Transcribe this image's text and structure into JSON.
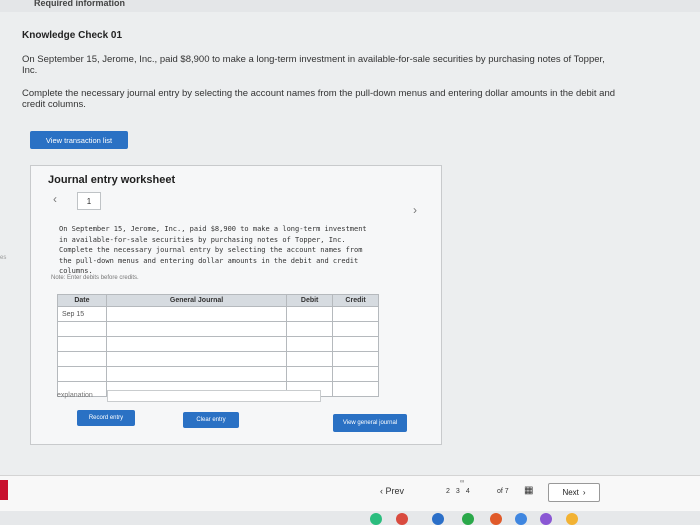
{
  "header": {
    "required_label": "Required information"
  },
  "question": {
    "title": "Knowledge Check 01",
    "paragraph1": "On September 15, Jerome, Inc., paid $8,900 to make a long-term investment in available-for-sale securities by purchasing notes of Topper, Inc.",
    "paragraph2": "Complete the necessary journal entry by selecting the account names from the pull-down menus and entering dollar amounts in the debit and credit columns."
  },
  "buttons": {
    "view_transaction_list": "View transaction list",
    "record_entry": "Record entry",
    "clear_entry": "Clear entry",
    "view_general_journal": "View general journal"
  },
  "worksheet": {
    "title": "Journal entry worksheet",
    "tab_number": "1",
    "description": "On September 15, Jerome, Inc., paid $8,900 to make a long-term investment in available-for-sale securities by purchasing notes of Topper, Inc. Complete the necessary journal entry by selecting the account names from the pull-down menus and entering dollar amounts in the debit and credit columns.",
    "note": "Note: Enter debits before credits.",
    "columns": [
      "Date",
      "General Journal",
      "Debit",
      "Credit"
    ],
    "rows": [
      {
        "date": "Sep 15",
        "account": "",
        "debit": "",
        "credit": ""
      },
      {
        "date": "",
        "account": "",
        "debit": "",
        "credit": ""
      },
      {
        "date": "",
        "account": "",
        "debit": "",
        "credit": ""
      },
      {
        "date": "",
        "account": "",
        "debit": "",
        "credit": ""
      },
      {
        "date": "",
        "account": "",
        "debit": "",
        "credit": ""
      },
      {
        "date": "",
        "account": "",
        "debit": "",
        "credit": ""
      }
    ],
    "explanation_label": "explanation"
  },
  "pagination": {
    "prev_label": "Prev",
    "pages": [
      "2",
      "3",
      "4"
    ],
    "of_label": "of 7",
    "next_label": "Next"
  },
  "icons": {
    "left_chevron": "‹",
    "right_chevron": "›",
    "grid": "▦"
  },
  "colors": {
    "accent_blue": "#2a71c4",
    "brand_red": "#c8102e"
  }
}
